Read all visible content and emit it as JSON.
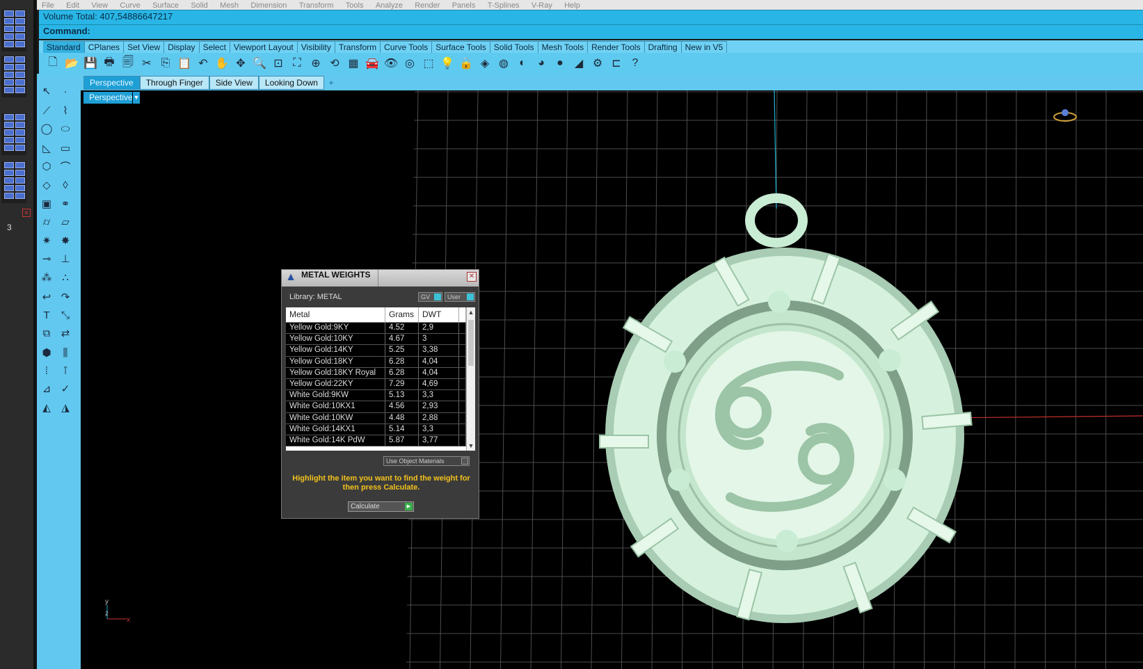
{
  "menu": [
    "File",
    "Edit",
    "View",
    "Curve",
    "Surface",
    "Solid",
    "Mesh",
    "Dimension",
    "Transform",
    "Tools",
    "Analyze",
    "Render",
    "Panels",
    "T-Splines",
    "V-Ray",
    "Help"
  ],
  "status": {
    "volume_total": "Volume Total: 407,54886647217",
    "command_label": "Command:"
  },
  "toolbar_tabs": [
    "Standard",
    "CPlanes",
    "Set View",
    "Display",
    "Select",
    "Viewport Layout",
    "Visibility",
    "Transform",
    "Curve Tools",
    "Surface Tools",
    "Solid Tools",
    "Mesh Tools",
    "Render Tools",
    "Drafting",
    "New in V5"
  ],
  "viewport_tabs": [
    "Perspective",
    "Through Finger",
    "Side View",
    "Looking Down"
  ],
  "viewport_label": "Perspective",
  "left_panel_number": "3",
  "axis": {
    "y": "y",
    "z": "z",
    "x": "x"
  },
  "dialog": {
    "title": "METAL WEIGHTS",
    "library": "Library: METAL",
    "gv_label": "GV",
    "user_label": "User",
    "columns": [
      "Metal",
      "Grams",
      "DWT"
    ],
    "rows": [
      [
        "Yellow Gold:9KY",
        "4.52",
        "2,9"
      ],
      [
        "Yellow Gold:10KY",
        "4.67",
        "3"
      ],
      [
        "Yellow Gold:14KY",
        "5.25",
        "3,38"
      ],
      [
        "Yellow Gold:18KY",
        "6.28",
        "4,04"
      ],
      [
        "Yellow Gold:18KY Royal",
        "6.28",
        "4,04"
      ],
      [
        "Yellow Gold:22KY",
        "7.29",
        "4,69"
      ],
      [
        "White Gold:9KW",
        "5.13",
        "3,3"
      ],
      [
        "White Gold:10KX1",
        "4.56",
        "2,93"
      ],
      [
        "White Gold:10KW",
        "4.48",
        "2,88"
      ],
      [
        "White Gold:14KX1",
        "5.14",
        "3,3"
      ],
      [
        "White Gold:14K PdW",
        "5.87",
        "3,77"
      ]
    ],
    "use_object_materials": "Use Object Materials",
    "hint": "Highlight the item you want to find the weight for then press Calculate.",
    "calculate": "Calculate"
  },
  "colors": {
    "ui_blue": "#29b6e6",
    "pendant": "#c9ecd4",
    "hint": "#f2c21c"
  }
}
